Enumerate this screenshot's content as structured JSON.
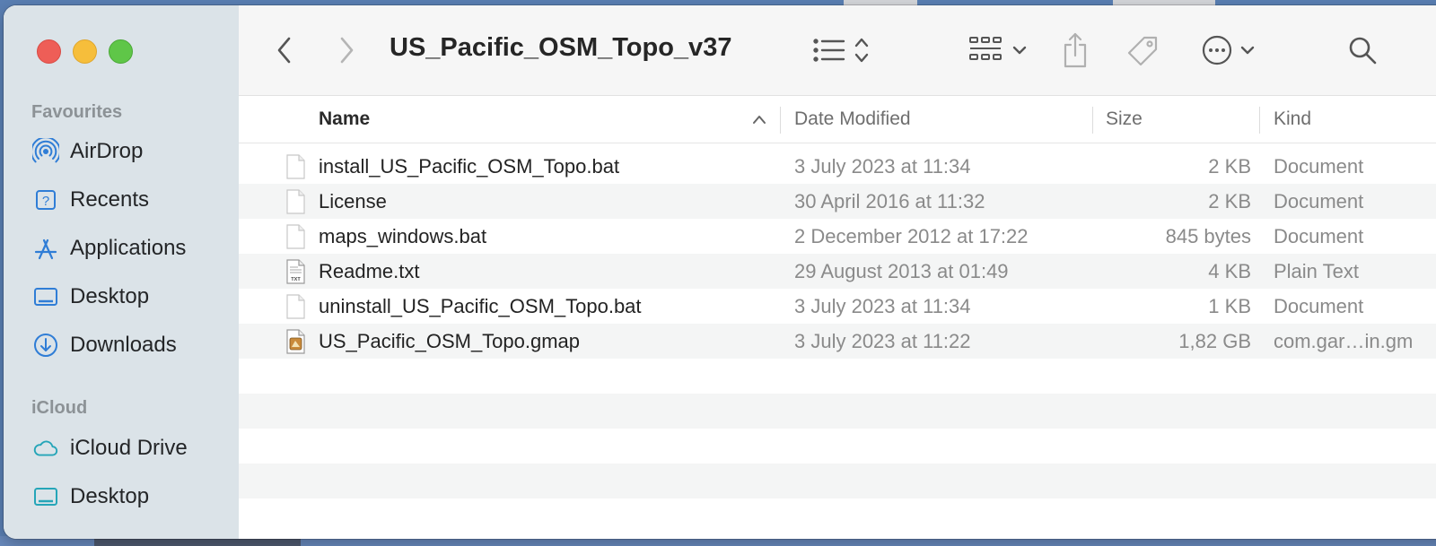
{
  "window": {
    "title": "US_Pacific_OSM_Topo_v37"
  },
  "sidebar": {
    "sections": [
      {
        "title": "Favourites",
        "items": [
          {
            "label": "AirDrop",
            "icon": "airdrop-icon"
          },
          {
            "label": "Recents",
            "icon": "recents-icon"
          },
          {
            "label": "Applications",
            "icon": "applications-icon"
          },
          {
            "label": "Desktop",
            "icon": "desktop-icon"
          },
          {
            "label": "Downloads",
            "icon": "downloads-icon"
          }
        ]
      },
      {
        "title": "iCloud",
        "items": [
          {
            "label": "iCloud Drive",
            "icon": "icloud-icon"
          },
          {
            "label": "Desktop",
            "icon": "desktop-icon"
          }
        ]
      }
    ]
  },
  "toolbar": {
    "icons": [
      "back-icon",
      "forward-icon",
      "list-view-icon",
      "sort-icon",
      "grid-view-icon",
      "chevron-down-icon",
      "share-icon",
      "tag-icon",
      "more-icon",
      "chevron-down-icon",
      "search-icon"
    ]
  },
  "columns": {
    "name": "Name",
    "date": "Date Modified",
    "size": "Size",
    "kind": "Kind",
    "sorted_by": "name"
  },
  "files": [
    {
      "name": "install_US_Pacific_OSM_Topo.bat",
      "date": "3 July 2023 at 11:34",
      "size": "2 KB",
      "kind": "Document",
      "icon": "document-icon"
    },
    {
      "name": "License",
      "date": "30 April 2016 at 11:32",
      "size": "2 KB",
      "kind": "Document",
      "icon": "document-icon"
    },
    {
      "name": "maps_windows.bat",
      "date": "2 December 2012 at 17:22",
      "size": "845 bytes",
      "kind": "Document",
      "icon": "document-icon"
    },
    {
      "name": "Readme.txt",
      "date": "29 August 2013 at 01:49",
      "size": "4 KB",
      "kind": "Plain Text",
      "icon": "text-file-icon"
    },
    {
      "name": "uninstall_US_Pacific_OSM_Topo.bat",
      "date": "3 July 2023 at 11:34",
      "size": "1 KB",
      "kind": "Document",
      "icon": "document-icon"
    },
    {
      "name": "US_Pacific_OSM_Topo.gmap",
      "date": "3 July 2023 at 11:22",
      "size": "1,82 GB",
      "kind": "com.gar…in.gm",
      "icon": "gmap-file-icon"
    }
  ],
  "colors": {
    "sidebar_bg": "#dbe3e8",
    "accent": "#2f7dd6",
    "close": "#ee5e57",
    "minimize": "#f6be3b",
    "zoom": "#5fc648"
  }
}
